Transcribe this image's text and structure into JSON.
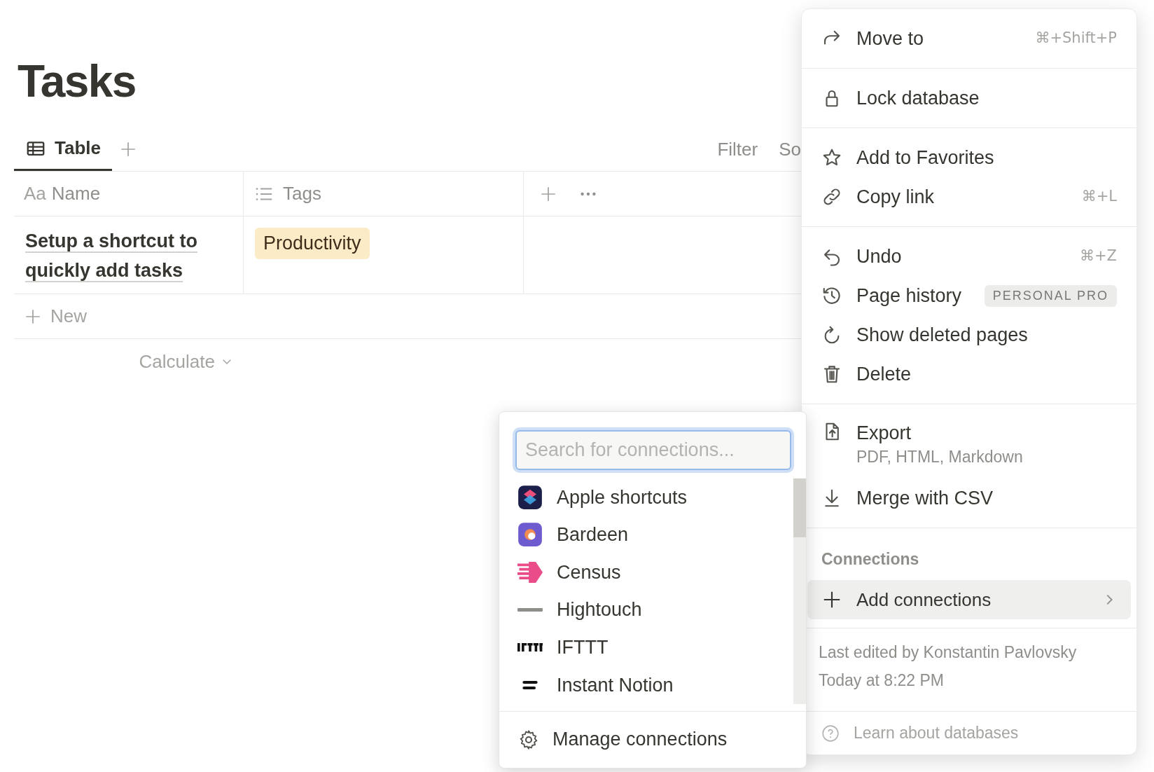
{
  "page": {
    "title": "Tasks"
  },
  "views": {
    "tabs": [
      {
        "label": "Table",
        "selected": true
      }
    ],
    "actions": [
      "Filter",
      "So"
    ]
  },
  "table": {
    "columns": [
      {
        "kind": "title",
        "type_icon": "Aa",
        "label": "Name"
      },
      {
        "kind": "multi_select",
        "label": "Tags"
      }
    ],
    "rows": [
      {
        "name": "Setup a shortcut to quickly add tasks",
        "tags": [
          "Productivity"
        ]
      }
    ],
    "new_label": "New",
    "calculate_label": "Calculate"
  },
  "menu": {
    "groups": [
      [
        {
          "kind": "move",
          "label": "Move to",
          "shortcut": "⌘+Shift+P"
        }
      ],
      [
        {
          "kind": "lock",
          "label": "Lock database"
        }
      ],
      [
        {
          "kind": "star",
          "label": "Add to Favorites"
        },
        {
          "kind": "link",
          "label": "Copy link",
          "shortcut": "⌘+L"
        }
      ],
      [
        {
          "kind": "undo",
          "label": "Undo",
          "shortcut": "⌘+Z"
        },
        {
          "kind": "history",
          "label": "Page history",
          "badge": "PERSONAL PRO"
        },
        {
          "kind": "restore",
          "label": "Show deleted pages"
        },
        {
          "kind": "trash",
          "label": "Delete"
        }
      ],
      [
        {
          "kind": "export",
          "label": "Export",
          "description": "PDF, HTML, Markdown"
        },
        {
          "kind": "download",
          "label": "Merge with CSV"
        }
      ]
    ],
    "connections": {
      "header": "Connections",
      "item": {
        "label": "Add connections",
        "selected": true
      }
    },
    "footer": {
      "last_edited": "Last edited by Konstantin Pavlovsky",
      "time": "Today at 8:22 PM",
      "help": "Learn about databases"
    }
  },
  "connections_popup": {
    "placeholder": "Search for connections...",
    "items": [
      {
        "kind": "shortcuts",
        "label": "Apple shortcuts"
      },
      {
        "kind": "bardeen",
        "label": "Bardeen"
      },
      {
        "kind": "census",
        "label": "Census"
      },
      {
        "kind": "hightouch",
        "label": "Hightouch"
      },
      {
        "kind": "ifttt",
        "label": "IFTTT"
      },
      {
        "kind": "instant",
        "label": "Instant Notion"
      }
    ],
    "manage": "Manage connections"
  }
}
